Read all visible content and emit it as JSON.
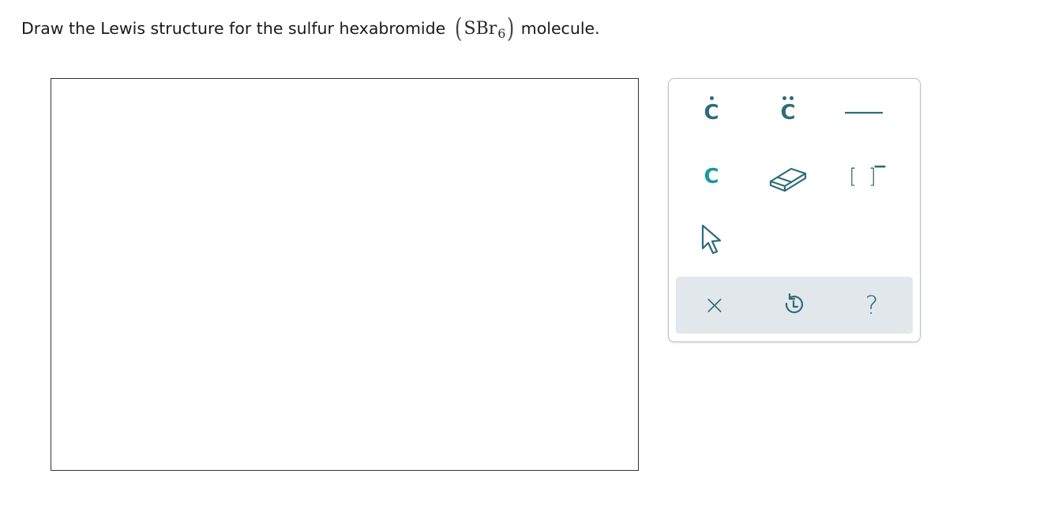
{
  "question": {
    "text_before": "Draw the Lewis structure for the sulfur hexabromide",
    "formula_main": "SBr",
    "formula_subscript": "6",
    "text_after": "molecule."
  },
  "palette": {
    "row1": [
      {
        "label": "C",
        "icon": "single-electron-icon"
      },
      {
        "label": "C",
        "icon": "lone-pair-icon"
      },
      {
        "label": "",
        "icon": "single-bond-icon"
      }
    ],
    "row2": [
      {
        "label": "C",
        "icon": "atom-icon"
      },
      {
        "label": "",
        "icon": "eraser-icon"
      },
      {
        "label": "[ ]",
        "icon": "bracket-charge-icon",
        "charge": "−"
      }
    ],
    "row3": [
      {
        "label": "",
        "icon": "pointer-icon"
      }
    ],
    "bottom": {
      "clear": "×",
      "undo": "",
      "help": "?"
    },
    "colors": {
      "icon": "#2f6b7a",
      "atom_accent": "#1b97a6",
      "bar_bg": "#e1e7ea",
      "border": "#b9c3c8"
    }
  }
}
